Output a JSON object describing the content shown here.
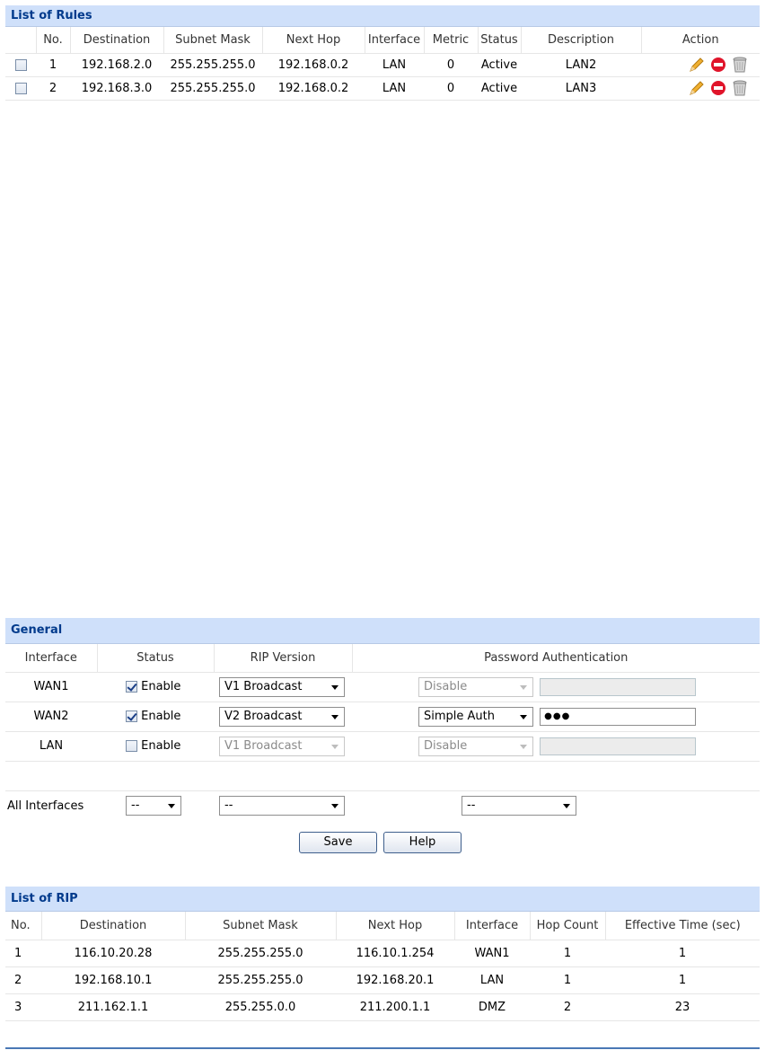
{
  "rules": {
    "title": "List of Rules",
    "columns": [
      "",
      "No.",
      "Destination",
      "Subnet Mask",
      "Next Hop",
      "Interface",
      "Metric",
      "Status",
      "Description",
      "Action"
    ],
    "rows": [
      {
        "no": "1",
        "destination": "192.168.2.0",
        "mask": "255.255.255.0",
        "next_hop": "192.168.0.2",
        "interface": "LAN",
        "metric": "0",
        "status": "Active",
        "description": "LAN2",
        "checked": false
      },
      {
        "no": "2",
        "destination": "192.168.3.0",
        "mask": "255.255.255.0",
        "next_hop": "192.168.0.2",
        "interface": "LAN",
        "metric": "0",
        "status": "Active",
        "description": "LAN3",
        "checked": false
      }
    ],
    "action_icons": [
      "edit-pencil-icon",
      "disable-icon",
      "delete-trash-icon"
    ]
  },
  "general": {
    "title": "General",
    "columns": [
      "Interface",
      "Status",
      "RIP Version",
      "Password Authentication"
    ],
    "rows": [
      {
        "interface": "WAN1",
        "enabled": true,
        "enable_label": "Enable",
        "rip_version": "V1 Broadcast",
        "rip_disabled": false,
        "auth": "Disable",
        "auth_disabled": true,
        "password": "",
        "password_disabled": true
      },
      {
        "interface": "WAN2",
        "enabled": true,
        "enable_label": "Enable",
        "rip_version": "V2 Broadcast",
        "rip_disabled": false,
        "auth": "Simple Auth",
        "auth_disabled": false,
        "password": "●●●",
        "password_disabled": false
      },
      {
        "interface": "LAN",
        "enabled": false,
        "enable_label": "Enable",
        "rip_version": "V1 Broadcast",
        "rip_disabled": true,
        "auth": "Disable",
        "auth_disabled": true,
        "password": "",
        "password_disabled": true
      }
    ],
    "all_interfaces": {
      "label": "All Interfaces",
      "status": "--",
      "rip_version": "--",
      "auth": "--"
    },
    "buttons": {
      "save": "Save",
      "help": "Help"
    }
  },
  "rip": {
    "title": "List of RIP",
    "columns": [
      "No.",
      "Destination",
      "Subnet Mask",
      "Next Hop",
      "Interface",
      "Hop Count",
      "Effective Time (sec)"
    ],
    "rows": [
      {
        "no": "1",
        "destination": "116.10.20.28",
        "mask": "255.255.255.0",
        "next_hop": "116.10.1.254",
        "interface": "WAN1",
        "hop": "1",
        "time": "1"
      },
      {
        "no": "2",
        "destination": "192.168.10.1",
        "mask": "255.255.255.0",
        "next_hop": "192.168.20.1",
        "interface": "LAN",
        "hop": "1",
        "time": "1"
      },
      {
        "no": "3",
        "destination": "211.162.1.1",
        "mask": "255.255.0.0",
        "next_hop": "211.200.1.1",
        "interface": "DMZ",
        "hop": "2",
        "time": "23"
      }
    ]
  },
  "colors": {
    "panel_header": "#cfe0fa",
    "panel_title": "#003a8c",
    "footer_line": "#4a78b5"
  }
}
